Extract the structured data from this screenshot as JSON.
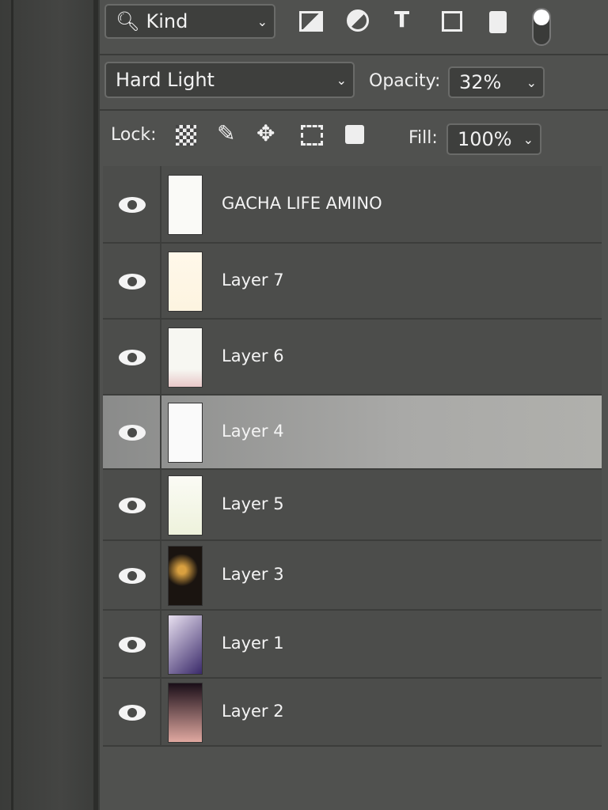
{
  "filter": {
    "label": "Kind",
    "icons": [
      "image-filter-icon",
      "adjustment-filter-icon",
      "type-filter-icon",
      "shape-filter-icon",
      "smart-object-filter-icon",
      "filter-toggle"
    ]
  },
  "blend": {
    "mode": "Hard Light",
    "opacity_label": "Opacity:",
    "opacity": "32%"
  },
  "lock": {
    "label": "Lock:",
    "icons": [
      "lock-transparent-icon",
      "lock-image-icon",
      "lock-position-icon",
      "lock-artboard-icon",
      "lock-all-icon"
    ],
    "fill_label": "Fill:",
    "fill": "100%"
  },
  "layers": [
    {
      "name": "GACHA LIFE AMINO",
      "visible": true,
      "selected": false
    },
    {
      "name": "Layer 7",
      "visible": true,
      "selected": false
    },
    {
      "name": "Layer 6",
      "visible": true,
      "selected": false
    },
    {
      "name": "Layer 4",
      "visible": true,
      "selected": true
    },
    {
      "name": "Layer 5",
      "visible": true,
      "selected": false
    },
    {
      "name": "Layer 3",
      "visible": true,
      "selected": false
    },
    {
      "name": "Layer 1",
      "visible": true,
      "selected": false
    },
    {
      "name": "Layer 2",
      "visible": true,
      "selected": false
    }
  ]
}
